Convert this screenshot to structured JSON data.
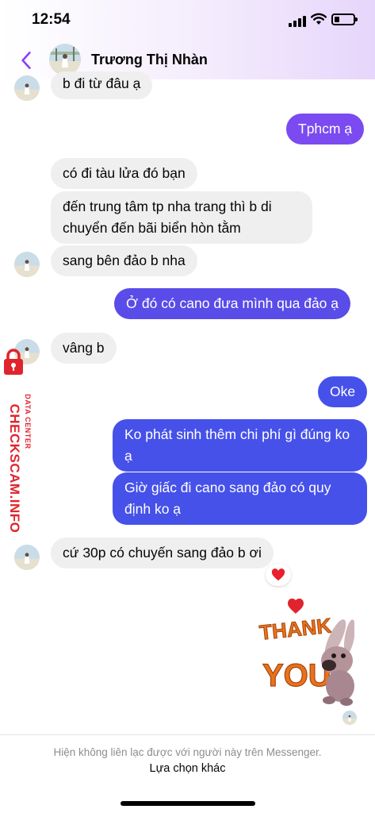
{
  "status_bar": {
    "time": "12:54"
  },
  "header": {
    "contact_name": "Trương Thị Nhàn"
  },
  "messages": [
    {
      "sender": "contact",
      "text": "b đi từ đâu ạ"
    },
    {
      "sender": "me",
      "text": "Tphcm ạ"
    },
    {
      "sender": "contact",
      "text": "có đi tàu lửa đó bạn"
    },
    {
      "sender": "contact",
      "text": "đến trung tâm tp nha trang thì b di chuyển đến bãi biển hòn tằm"
    },
    {
      "sender": "contact",
      "text": "sang bên đảo b nha"
    },
    {
      "sender": "me",
      "text": "Ở đó có cano đưa mình qua đảo ạ"
    },
    {
      "sender": "contact",
      "text": "vâng b"
    },
    {
      "sender": "me",
      "text": "Oke"
    },
    {
      "sender": "me",
      "text": "Ko phát sinh thêm chi phí gì đúng ko ạ"
    },
    {
      "sender": "me",
      "text": "Giờ giấc đi cano sang đảo có quy định ko ạ"
    },
    {
      "sender": "contact",
      "text": "cứ 30p có chuyến sang đảo b ơi",
      "reaction": "heart"
    }
  ],
  "sticker": {
    "text_line1": "THANK",
    "text_line2": "YOU!"
  },
  "watermark": {
    "main": "CHECKSCAM.INFO",
    "sub": "DATA CENTER"
  },
  "footer": {
    "notice": "Hiện không liên lạc được với người này trên Messenger.",
    "option": "Lựa chọn khác"
  },
  "colors": {
    "outgoing_purple": "#7b4af0",
    "outgoing_blue": "#4651ea",
    "incoming": "#efeff0",
    "accent": "#8a3ffc",
    "watermark_red": "#e0242d"
  }
}
